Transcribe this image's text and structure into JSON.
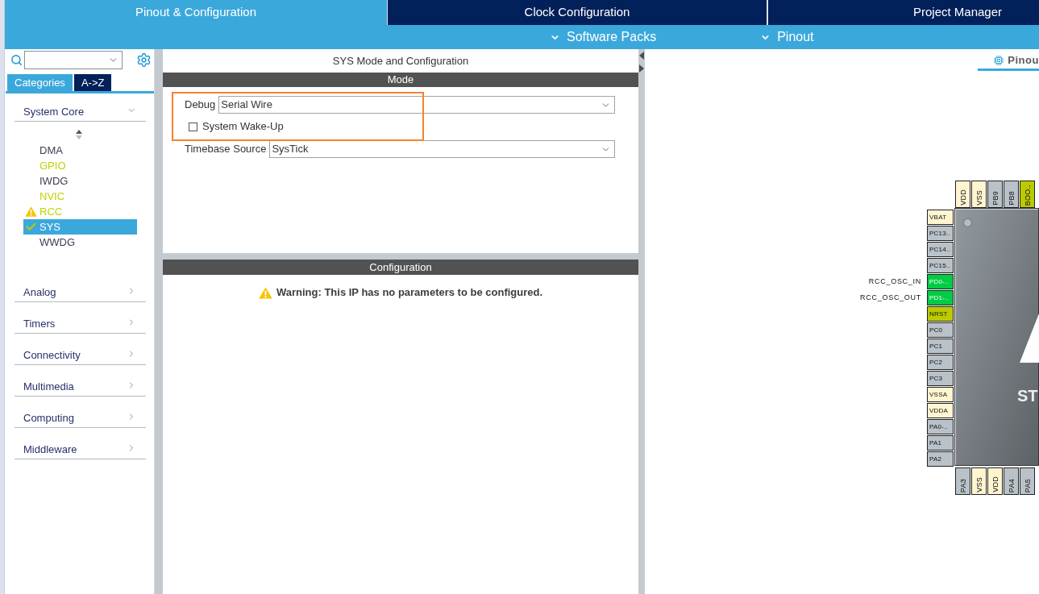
{
  "top_tabs": [
    {
      "label": "Pinout & Configuration",
      "selected": true
    },
    {
      "label": "Clock Configuration",
      "selected": false
    },
    {
      "label": "Project Manager",
      "selected": false
    }
  ],
  "menu_bar": [
    {
      "label": "Software Packs"
    },
    {
      "label": "Pinout"
    }
  ],
  "sidebar": {
    "tabs": [
      {
        "label": "Categories",
        "selected": true
      },
      {
        "label": "A->Z",
        "selected": false
      }
    ],
    "categories": [
      {
        "label": "System Core",
        "expanded": true,
        "children": [
          {
            "label": "DMA",
            "configured": false,
            "warning": false,
            "ok": false,
            "selected": false
          },
          {
            "label": "GPIO",
            "configured": true,
            "warning": false,
            "ok": false,
            "selected": false
          },
          {
            "label": "IWDG",
            "configured": false,
            "warning": false,
            "ok": false,
            "selected": false
          },
          {
            "label": "NVIC",
            "configured": true,
            "warning": false,
            "ok": false,
            "selected": false
          },
          {
            "label": "RCC",
            "configured": true,
            "warning": true,
            "ok": false,
            "selected": false
          },
          {
            "label": "SYS",
            "configured": false,
            "warning": false,
            "ok": true,
            "selected": true
          },
          {
            "label": "WWDG",
            "configured": false,
            "warning": false,
            "ok": false,
            "selected": false
          }
        ]
      },
      {
        "label": "Analog",
        "expanded": false
      },
      {
        "label": "Timers",
        "expanded": false
      },
      {
        "label": "Connectivity",
        "expanded": false
      },
      {
        "label": "Multimedia",
        "expanded": false
      },
      {
        "label": "Computing",
        "expanded": false
      },
      {
        "label": "Middleware",
        "expanded": false
      }
    ]
  },
  "mode_panel": {
    "title": "SYS Mode and Configuration",
    "header": "Mode",
    "fields": [
      {
        "kind": "select",
        "label": "Debug",
        "value": "Serial Wire",
        "highlighted": true
      },
      {
        "kind": "checkbox",
        "label": "System Wake-Up",
        "checked": false,
        "highlighted": true
      },
      {
        "kind": "select",
        "label": "Timebase Source",
        "value": "SysTick",
        "highlighted": false
      }
    ]
  },
  "configuration_panel": {
    "header": "Configuration",
    "warning": "Warning: This IP has no parameters to be configured."
  },
  "pinout_view": {
    "tab": {
      "label": "Pinou",
      "selected": true
    },
    "chip": {
      "marking": "ST",
      "top_pins": [
        {
          "label": "VDD",
          "color": "#fff5d0"
        },
        {
          "label": "VSS",
          "color": "#fff5d0"
        },
        {
          "label": "PB9",
          "color": "#b9c2c8"
        },
        {
          "label": "PB8",
          "color": "#b9c2c8"
        },
        {
          "label": "BOO..",
          "color": "#bccb00"
        }
      ],
      "left_pins": [
        {
          "label": "VBAT",
          "color": "#fff5d0"
        },
        {
          "label": "PC13..",
          "color": "#b9c2c8"
        },
        {
          "label": "PC14..",
          "color": "#b9c2c8"
        },
        {
          "label": "PC15..",
          "color": "#b9c2c8"
        },
        {
          "label": "PD0-..",
          "color": "#00cc44",
          "signal": "RCC_OSC_IN"
        },
        {
          "label": "PD1-..",
          "color": "#00cc44",
          "signal": "RCC_OSC_OUT"
        },
        {
          "label": "NRST",
          "color": "#bccb00"
        },
        {
          "label": "PC0",
          "color": "#b9c2c8"
        },
        {
          "label": "PC1",
          "color": "#b9c2c8"
        },
        {
          "label": "PC2",
          "color": "#b9c2c8"
        },
        {
          "label": "PC3",
          "color": "#b9c2c8"
        },
        {
          "label": "VSSA",
          "color": "#fff5d0"
        },
        {
          "label": "VDDA",
          "color": "#fff5d0"
        },
        {
          "label": "PA0-..",
          "color": "#b9c2c8"
        },
        {
          "label": "PA1",
          "color": "#b9c2c8"
        },
        {
          "label": "PA2",
          "color": "#b9c2c8"
        }
      ],
      "bottom_pins": [
        {
          "label": "PA3",
          "color": "#b9c2c8"
        },
        {
          "label": "VSS",
          "color": "#fff5d0"
        },
        {
          "label": "VDD",
          "color": "#fff5d0"
        },
        {
          "label": "PA4",
          "color": "#b9c2c8"
        },
        {
          "label": "PA5",
          "color": "#b9c2c8"
        }
      ]
    }
  }
}
